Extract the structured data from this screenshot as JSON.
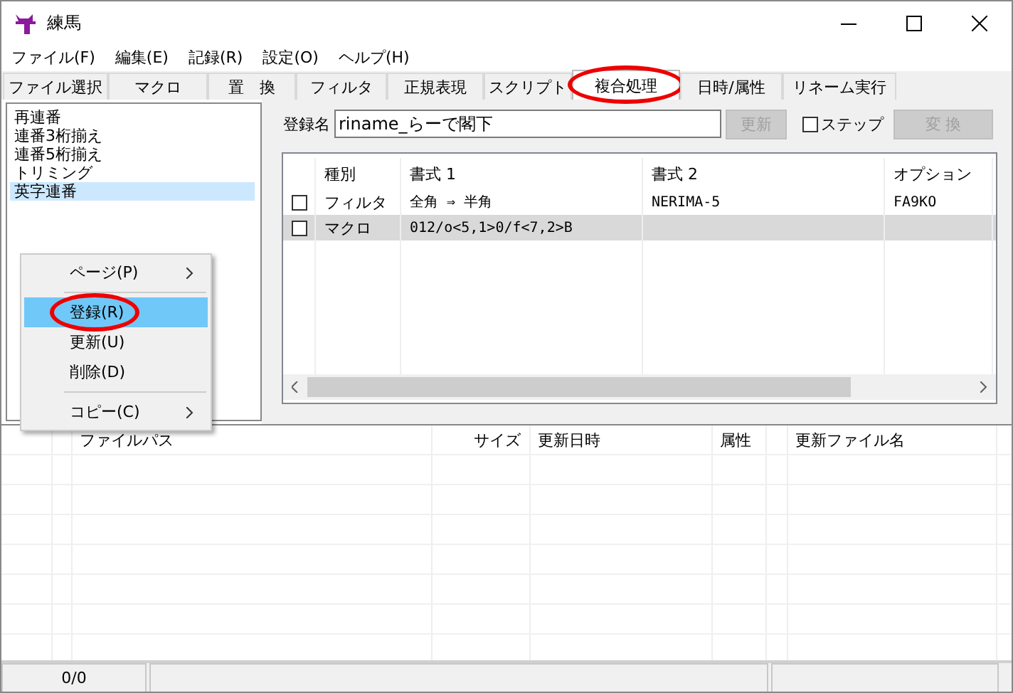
{
  "window": {
    "title": "練馬"
  },
  "menu": [
    "ファイル(F)",
    "編集(E)",
    "記録(R)",
    "設定(O)",
    "ヘルプ(H)"
  ],
  "tabs": [
    {
      "label": "ファイル選択",
      "selected": false,
      "circled": false
    },
    {
      "label": "マクロ",
      "selected": false,
      "circled": false
    },
    {
      "label": "置　換",
      "selected": false,
      "circled": false
    },
    {
      "label": "フィルタ",
      "selected": false,
      "circled": false
    },
    {
      "label": "正規表現",
      "selected": false,
      "circled": false
    },
    {
      "label": "スクリプト",
      "selected": false,
      "circled": false
    },
    {
      "label": "複合処理",
      "selected": true,
      "circled": true
    },
    {
      "label": "日時/属性",
      "selected": false,
      "circled": false
    },
    {
      "label": "リネーム実行",
      "selected": false,
      "circled": false
    }
  ],
  "preset_list": [
    {
      "label": "再連番",
      "selected": false
    },
    {
      "label": "連番3桁揃え",
      "selected": false
    },
    {
      "label": "連番5桁揃え",
      "selected": false
    },
    {
      "label": "トリミング",
      "selected": false
    },
    {
      "label": "英字連番",
      "selected": true
    }
  ],
  "context_menu": [
    {
      "kind": "item",
      "label": "ページ(P)",
      "submenu": true,
      "selected": false,
      "circled": false
    },
    {
      "kind": "separator"
    },
    {
      "kind": "item",
      "label": "登録(R)",
      "submenu": false,
      "selected": true,
      "circled": true
    },
    {
      "kind": "item",
      "label": "更新(U)",
      "submenu": false,
      "selected": false,
      "circled": false
    },
    {
      "kind": "item",
      "label": "削除(D)",
      "submenu": false,
      "selected": false,
      "circled": false
    },
    {
      "kind": "separator"
    },
    {
      "kind": "item",
      "label": "コピー(C)",
      "submenu": true,
      "selected": false,
      "circled": false
    }
  ],
  "register": {
    "label": "登録名",
    "value": "riname_らーで閣下",
    "update_button": {
      "label": "更新",
      "disabled": true
    },
    "step": {
      "label": "ステップ",
      "checked": false
    },
    "convert_button": {
      "label": "変 換",
      "disabled": true
    }
  },
  "steps_table": {
    "columns": [
      "種別",
      "書式 1",
      "書式 2",
      "オプション"
    ],
    "rows": [
      {
        "checked": false,
        "selected": false,
        "cells": [
          "フィルタ",
          "全角 ⇒ 半角",
          "NERIMA-5",
          "FA9KO"
        ]
      },
      {
        "checked": false,
        "selected": true,
        "cells": [
          "マクロ",
          "012/o<5,1>0/f<7,2>B",
          "",
          ""
        ]
      }
    ]
  },
  "file_table": {
    "columns": [
      "ファイルパス",
      "サイズ",
      "更新日時",
      "属性",
      "更新ファイル名"
    ]
  },
  "status_bar": [
    "0/0"
  ]
}
